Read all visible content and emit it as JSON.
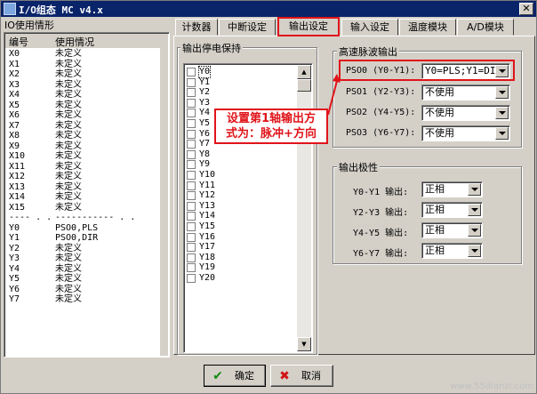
{
  "window": {
    "title": "I/O组态 MC v4.x",
    "close_glyph": "✕"
  },
  "usage": {
    "caption": "IO使用情形",
    "headers": [
      "编号",
      "使用情况"
    ],
    "rows": [
      [
        "X0",
        "未定义"
      ],
      [
        "X1",
        "未定义"
      ],
      [
        "X2",
        "未定义"
      ],
      [
        "X3",
        "未定义"
      ],
      [
        "X4",
        "未定义"
      ],
      [
        "X5",
        "未定义"
      ],
      [
        "X6",
        "未定义"
      ],
      [
        "X7",
        "未定义"
      ],
      [
        "X8",
        "未定义"
      ],
      [
        "X9",
        "未定义"
      ],
      [
        "X10",
        "未定义"
      ],
      [
        "X11",
        "未定义"
      ],
      [
        "X12",
        "未定义"
      ],
      [
        "X13",
        "未定义"
      ],
      [
        "X14",
        "未定义"
      ],
      [
        "X15",
        "未定义"
      ],
      [
        "---- . .",
        "----------- . ."
      ],
      [
        "Y0",
        "PSO0,PLS"
      ],
      [
        "Y1",
        "PSO0,DIR"
      ],
      [
        "Y2",
        "未定义"
      ],
      [
        "Y3",
        "未定义"
      ],
      [
        "Y4",
        "未定义"
      ],
      [
        "Y5",
        "未定义"
      ],
      [
        "Y6",
        "未定义"
      ],
      [
        "Y7",
        "未定义"
      ]
    ]
  },
  "tabs": [
    {
      "label": "计数器",
      "active": false
    },
    {
      "label": "中断设定",
      "active": false
    },
    {
      "label": "输出设定",
      "active": true
    },
    {
      "label": "输入设定",
      "active": false
    },
    {
      "label": "温度模块",
      "active": false
    },
    {
      "label": "A/D模块",
      "active": false
    }
  ],
  "output_hold": {
    "title": "输出停电保持",
    "items": [
      "Y0",
      "Y1",
      "Y2",
      "Y3",
      "Y4",
      "Y5",
      "Y6",
      "Y7",
      "Y8",
      "Y9",
      "Y10",
      "Y11",
      "Y12",
      "Y13",
      "Y14",
      "Y15",
      "Y16",
      "Y17",
      "Y18",
      "Y19",
      "Y20"
    ]
  },
  "annotation": {
    "line1": "设置第1轴输出方",
    "line2": "式为：脉冲+方向",
    "color": "#e0141a"
  },
  "pulse_output": {
    "title": "高速脉波输出",
    "rows": [
      {
        "label": "PSO0 (Y0-Y1):",
        "value": "Y0=PLS;Y1=DIR"
      },
      {
        "label": "PSO1 (Y2-Y3):",
        "value": "不使用"
      },
      {
        "label": "PSO2 (Y4-Y5):",
        "value": "不使用"
      },
      {
        "label": "PSO3 (Y6-Y7):",
        "value": "不使用"
      }
    ]
  },
  "polarity": {
    "title": "输出极性",
    "rows": [
      {
        "label": "Y0-Y1 输出:",
        "value": "正相"
      },
      {
        "label": "Y2-Y3 输出:",
        "value": "正相"
      },
      {
        "label": "Y4-Y5 输出:",
        "value": "正相"
      },
      {
        "label": "Y6-Y7 输出:",
        "value": "正相"
      }
    ]
  },
  "buttons": {
    "ok_label": "确定",
    "ok_icon": "✔",
    "cancel_label": "取消",
    "cancel_icon": "✖"
  },
  "watermark": "www.55dianzi.com"
}
